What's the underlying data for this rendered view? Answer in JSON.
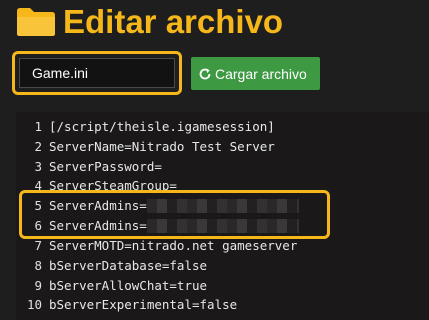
{
  "header": {
    "title": "Editar archivo",
    "icon": "folder-icon"
  },
  "file_input": {
    "value": "Game.ini"
  },
  "load_button": {
    "label": "Cargar archivo",
    "icon": "refresh-icon"
  },
  "colors": {
    "accent": "#f5b71a",
    "button": "#3d9a42",
    "background": "#1e1e1e"
  },
  "editor": {
    "lines": [
      {
        "num": "1",
        "text": "[/script/theisle.igamesession]"
      },
      {
        "num": "2",
        "text": "ServerName=Nitrado Test Server"
      },
      {
        "num": "3",
        "text": "ServerPassword="
      },
      {
        "num": "4",
        "text": "ServerSteamGroup="
      },
      {
        "num": "5",
        "text": "ServerAdmins="
      },
      {
        "num": "6",
        "text": "ServerAdmins="
      },
      {
        "num": "7",
        "text": "ServerMOTD=nitrado.net gameserver"
      },
      {
        "num": "8",
        "text": "bServerDatabase=false"
      },
      {
        "num": "9",
        "text": "bServerAllowChat=true"
      },
      {
        "num": "10",
        "text": "bServerExperimental=false"
      }
    ]
  }
}
